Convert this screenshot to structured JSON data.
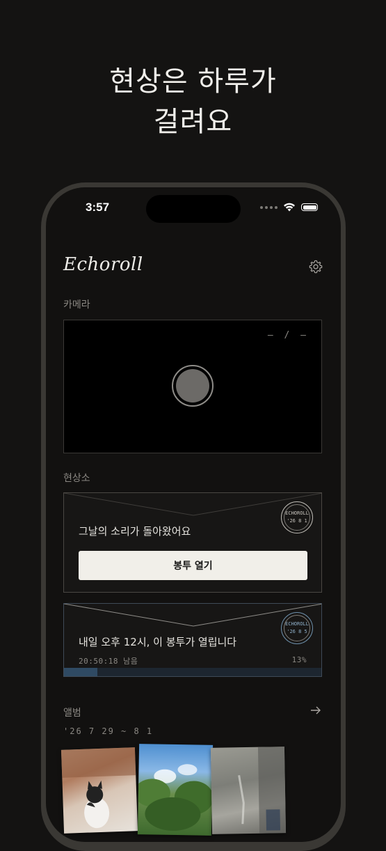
{
  "headline": {
    "line1": "현상은 하루가",
    "line2": "걸려요"
  },
  "status_bar": {
    "time": "3:57"
  },
  "app": {
    "title": "Echoroll"
  },
  "camera": {
    "section_label": "카메라",
    "counter": "– / –"
  },
  "developer": {
    "section_label": "현상소",
    "envelope_ready": {
      "message": "그날의 소리가 돌아왔어요",
      "button_label": "봉투 열기",
      "stamp": {
        "brand": "ECHOROLL",
        "date": "'26 8 1"
      }
    },
    "envelope_pending": {
      "message": "내일 오후 12시, 이 봉투가 열립니다",
      "remaining": "20:50:18 남음",
      "progress_label": "13%",
      "progress": 0.13,
      "stamp": {
        "brand": "ECHOROLL",
        "date": "'26 8 5"
      }
    }
  },
  "album": {
    "section_label": "앨범",
    "range": "'26 7 29 ~ 8 1",
    "photos": [
      "cat-photo",
      "trees-sky-photo",
      "glass-window-photo"
    ]
  },
  "colors": {
    "background": "#141312",
    "phone_frame": "#3a3834",
    "progress_fill": "#2f4a63",
    "button_bg": "#f1efe9"
  }
}
